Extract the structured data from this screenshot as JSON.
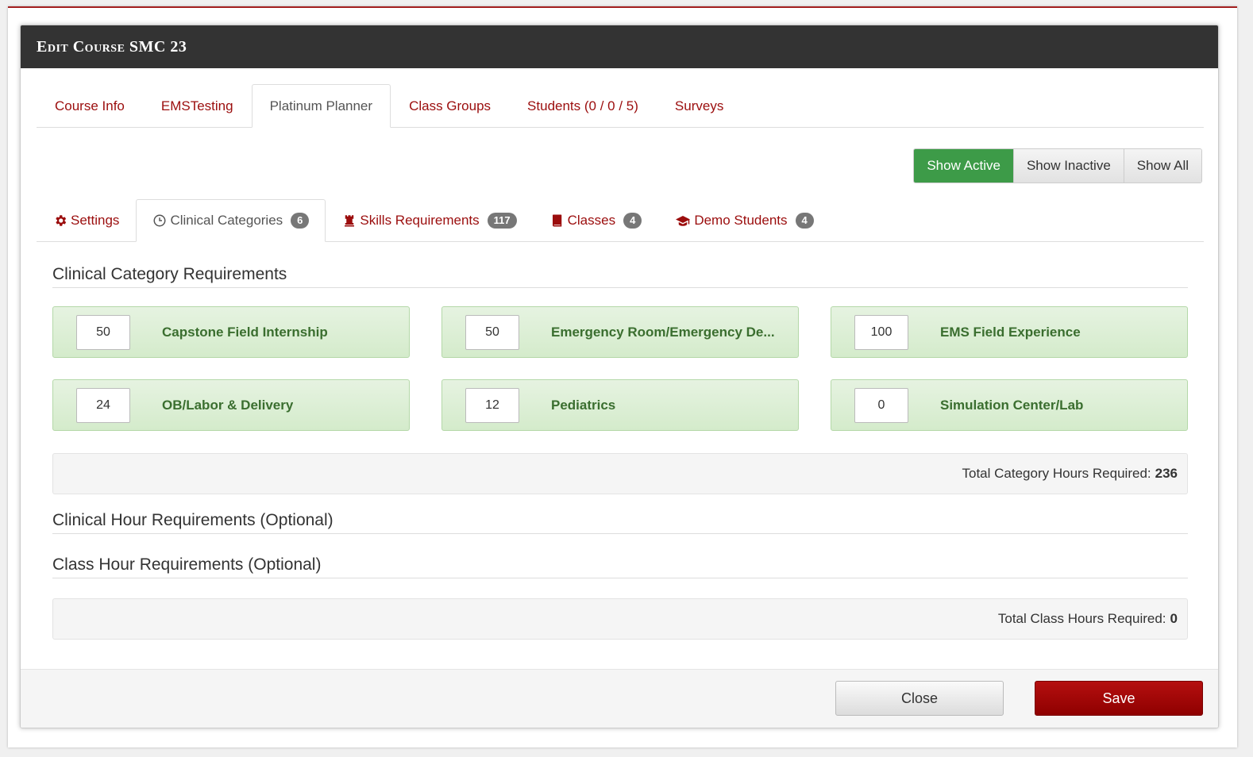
{
  "modal": {
    "title": "Edit Course SMC 23"
  },
  "main_tabs": [
    {
      "label": "Course Info"
    },
    {
      "label": "EMSTesting"
    },
    {
      "label": "Platinum Planner"
    },
    {
      "label": "Class Groups"
    },
    {
      "label": "Students (0 / 0 / 5)"
    },
    {
      "label": "Surveys"
    }
  ],
  "filters": {
    "show_active": "Show Active",
    "show_inactive": "Show Inactive",
    "show_all": "Show All"
  },
  "sub_tabs": [
    {
      "label": "Settings",
      "icon": "gear-icon"
    },
    {
      "label": "Clinical Categories",
      "icon": "clock-icon",
      "count": "6"
    },
    {
      "label": "Skills Requirements",
      "icon": "chess-icon",
      "count": "117"
    },
    {
      "label": "Classes",
      "icon": "book-icon",
      "count": "4"
    },
    {
      "label": "Demo Students",
      "icon": "graduation-cap-icon",
      "count": "4"
    }
  ],
  "sections": {
    "clinical_category": "Clinical Category Requirements",
    "clinical_hour": "Clinical Hour Requirements (Optional)",
    "class_hour": "Class Hour Requirements (Optional)"
  },
  "categories": [
    {
      "value": "50",
      "label": "Capstone Field Internship"
    },
    {
      "value": "50",
      "label": "Emergency Room/Emergency De..."
    },
    {
      "value": "100",
      "label": "EMS Field Experience"
    },
    {
      "value": "24",
      "label": "OB/Labor & Delivery"
    },
    {
      "value": "12",
      "label": "Pediatrics"
    },
    {
      "value": "0",
      "label": "Simulation Center/Lab"
    }
  ],
  "totals": {
    "category_label": "Total Category Hours Required:",
    "category_value": "236",
    "class_label": "Total Class Hours Required:",
    "class_value": "0"
  },
  "footer": {
    "close_label": "Close",
    "save_label": "Save"
  },
  "colors": {
    "accent": "#9b0d0d",
    "active_green": "#3d9b48",
    "category_text": "#3a6e2f"
  }
}
